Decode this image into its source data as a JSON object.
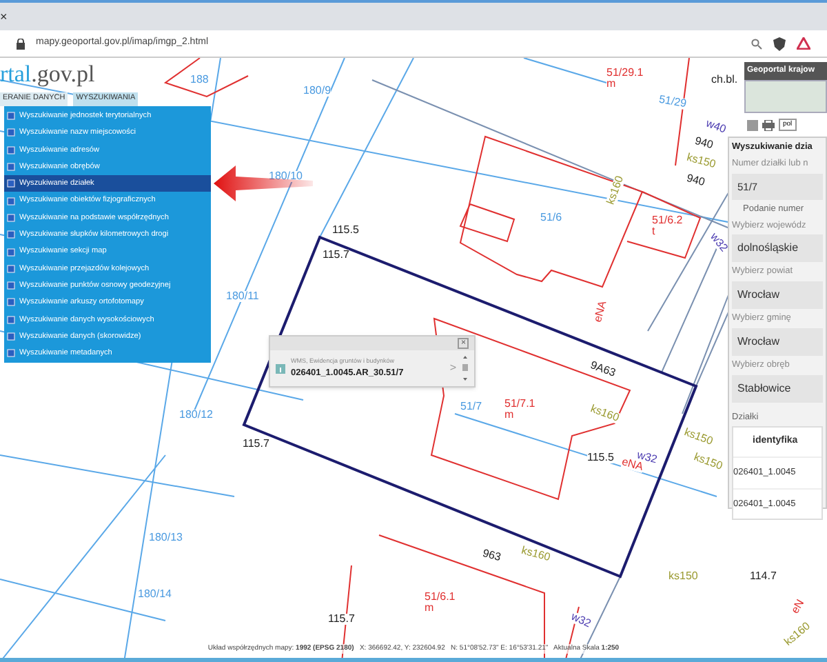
{
  "browser": {
    "tab_close": "×",
    "url": "mapy.geoportal.gov.pl/imap/imgp_2.html"
  },
  "logo": {
    "accent": "rtal",
    "rest": ".gov.pl"
  },
  "top_menu": [
    {
      "label": "ERANIE DANYCH",
      "selected": false
    },
    {
      "label": "WYSZUKIWANIA",
      "selected": true
    }
  ],
  "search_menu": [
    {
      "label": "Wyszukiwanie jednostek terytorialnych",
      "selected": false
    },
    {
      "label": "Wyszukiwanie nazw miejscowości",
      "selected": false
    },
    {
      "label": "Wyszukiwanie adresów",
      "selected": false
    },
    {
      "label": "Wyszukiwanie obrębów",
      "selected": false
    },
    {
      "label": "Wyszukiwanie działek",
      "selected": true
    },
    {
      "label": "Wyszukiwanie obiektów fizjograficznych",
      "selected": false
    },
    {
      "label": "Wyszukiwanie na podstawie współrzędnych",
      "selected": false
    },
    {
      "label": "Wyszukiwanie słupków kilometrowych drogi",
      "selected": false
    },
    {
      "label": "Wyszukiwanie sekcji map",
      "selected": false
    },
    {
      "label": "Wyszukiwanie przejazdów kolejowych",
      "selected": false
    },
    {
      "label": "Wyszukiwanie punktów osnowy geodezyjnej",
      "selected": false
    },
    {
      "label": "Wyszukiwanie arkuszy ortofotomapy",
      "selected": false
    },
    {
      "label": "Wyszukiwanie danych wysokościowych",
      "selected": false
    },
    {
      "label": "Wyszukiwanie danych (skorowidze)",
      "selected": false
    },
    {
      "label": "Wyszukiwanie metadanych",
      "selected": false
    }
  ],
  "map_labels": [
    {
      "text": "188",
      "kind": "parcel"
    },
    {
      "text": "180/9",
      "kind": "parcel"
    },
    {
      "text": "51/29.1",
      "kind": "building"
    },
    {
      "text": "m",
      "kind": "building"
    },
    {
      "text": "51/29",
      "kind": "parcel"
    },
    {
      "text": "ch.bl.",
      "kind": "height"
    },
    {
      "text": "w40",
      "kind": "water"
    },
    {
      "text": "940",
      "kind": "height"
    },
    {
      "text": "ks150",
      "kind": "utility"
    },
    {
      "text": "940",
      "kind": "height"
    },
    {
      "text": "180/10",
      "kind": "parcel"
    },
    {
      "text": "ks160",
      "kind": "utility"
    },
    {
      "text": "51/6",
      "kind": "parcel"
    },
    {
      "text": "51/6.2",
      "kind": "building"
    },
    {
      "text": "t",
      "kind": "building"
    },
    {
      "text": "w32",
      "kind": "water"
    },
    {
      "text": "115.5",
      "kind": "height"
    },
    {
      "text": "115.7",
      "kind": "height"
    },
    {
      "text": "180/11",
      "kind": "parcel"
    },
    {
      "text": "eNA",
      "kind": "building"
    },
    {
      "text": "9A63",
      "kind": "height"
    },
    {
      "text": "51/7",
      "kind": "parcel"
    },
    {
      "text": "51/7.1",
      "kind": "building"
    },
    {
      "text": "m",
      "kind": "building"
    },
    {
      "text": "ks160",
      "kind": "utility"
    },
    {
      "text": "115.7",
      "kind": "height"
    },
    {
      "text": "115.5",
      "kind": "height"
    },
    {
      "text": "eNA",
      "kind": "building"
    },
    {
      "text": "w32",
      "kind": "water"
    },
    {
      "text": "ks150",
      "kind": "utility"
    },
    {
      "text": "ks150",
      "kind": "utility"
    },
    {
      "text": "180/12",
      "kind": "parcel"
    },
    {
      "text": "180/13",
      "kind": "parcel"
    },
    {
      "text": "180/14",
      "kind": "parcel"
    },
    {
      "text": "963",
      "kind": "height"
    },
    {
      "text": "ks160",
      "kind": "utility"
    },
    {
      "text": "ks150",
      "kind": "utility"
    },
    {
      "text": "51/6.1",
      "kind": "building"
    },
    {
      "text": "m",
      "kind": "building"
    },
    {
      "text": "115.7",
      "kind": "height"
    },
    {
      "text": "w32",
      "kind": "water"
    },
    {
      "text": "114.7",
      "kind": "height"
    },
    {
      "text": "eN",
      "kind": "building"
    },
    {
      "text": "ks160",
      "kind": "utility"
    }
  ],
  "popup": {
    "source": "WMS, Ewidencja gruntów i budynków",
    "value": "026401_1.0045.AR_30.51/7",
    "close": "×",
    "next": ">"
  },
  "side_panel": {
    "header": "Geoportal krajow",
    "language": "pol",
    "title": "Wyszukiwanie dzia",
    "number_label": "Numer działki lub n",
    "number_value": "51/7",
    "hint": "Podanie numer",
    "selects": [
      {
        "label": "Wybierz wojewódz",
        "value": "dolnośląskie"
      },
      {
        "label": "Wybierz powiat",
        "value": "Wrocław"
      },
      {
        "label": "Wybierz gminę",
        "value": "Wrocław"
      },
      {
        "label": "Wybierz obręb",
        "value": "Stabłowice"
      }
    ],
    "results_label": "Działki",
    "column_1": "identyfika",
    "rows": [
      "026401_1.0045",
      "026401_1.0045"
    ]
  },
  "status_bar": "Układ współrzędnych mapy: **1992 (EPSG 2180)**   X: 366692.42, Y: 232604.92   N: 51°08'52.73\" E: 16°53'31.21\"   Aktualna Skala **1:250**"
}
